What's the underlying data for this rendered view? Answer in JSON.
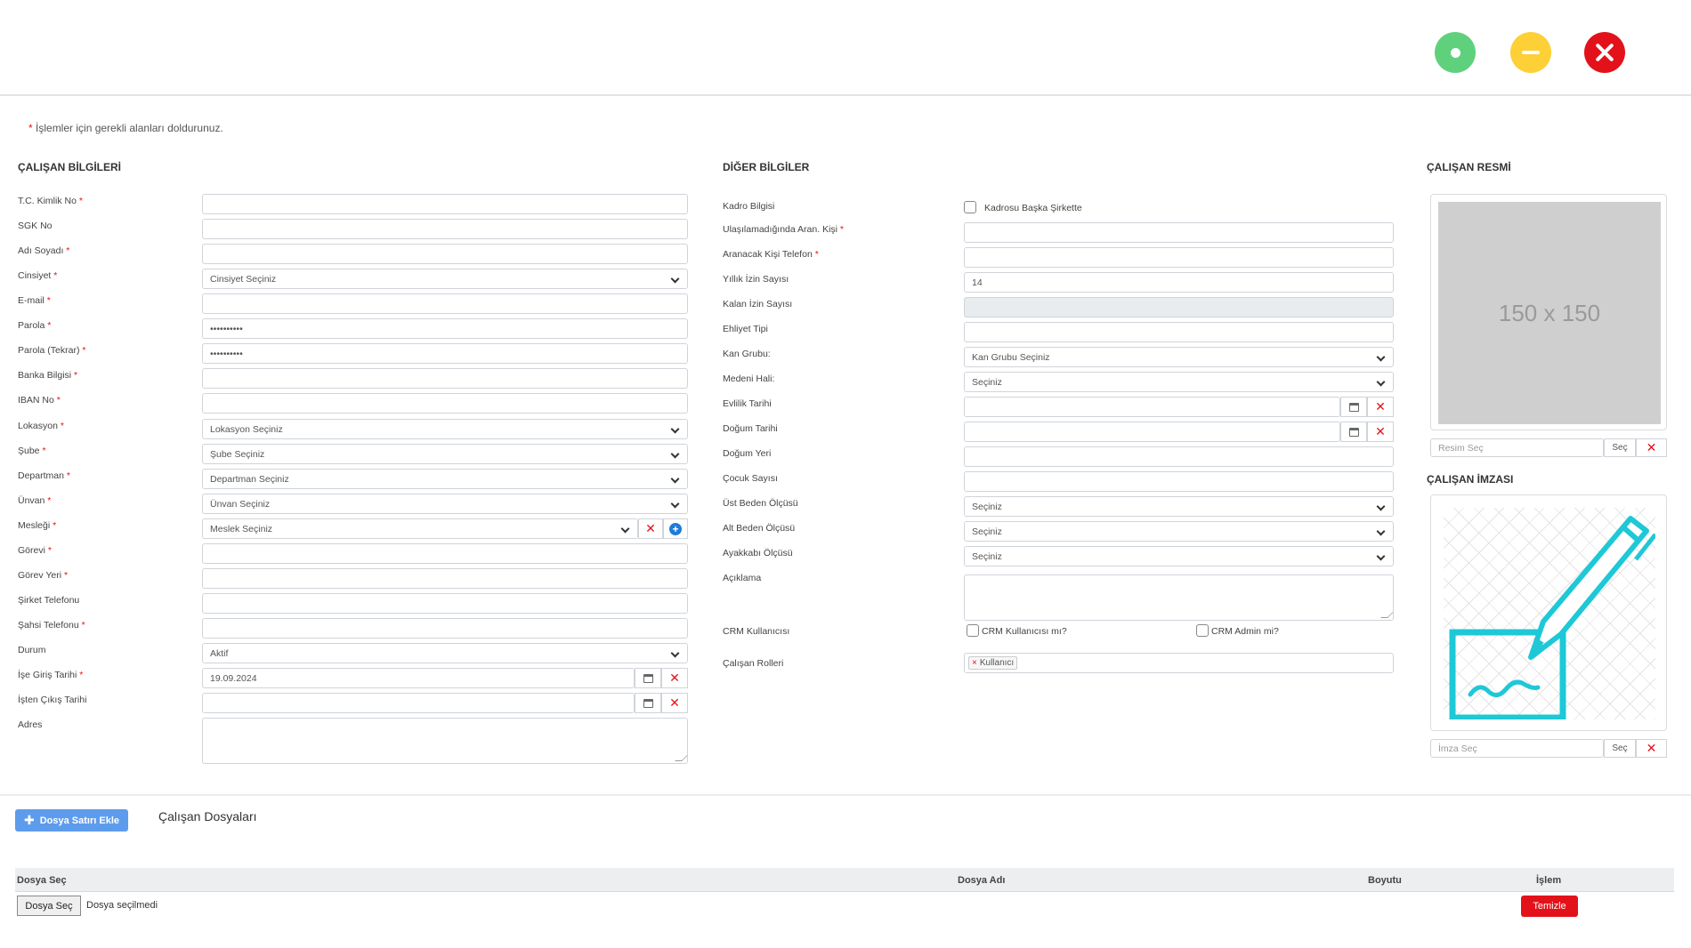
{
  "window": {
    "colors": {
      "green": "#5fd17c",
      "yellow": "#fcd036",
      "red": "#e3121a"
    }
  },
  "note": {
    "star": "*",
    "text": "İşlemler için gerekli alanları doldurunuz."
  },
  "left": {
    "title": "ÇALIŞAN BİLGİLERİ",
    "fields": [
      {
        "label": "T.C. Kimlik No",
        "required": "*",
        "value": ""
      },
      {
        "label": "SGK No",
        "required": "",
        "value": ""
      },
      {
        "label": "Adı Soyadı",
        "required": "*",
        "value": ""
      },
      {
        "label": "Cinsiyet",
        "required": "*",
        "value": "Cinsiyet Seçiniz"
      },
      {
        "label": "E-mail",
        "required": "*",
        "value": ""
      },
      {
        "label": "Parola",
        "required": "*",
        "value": "••••••••••"
      },
      {
        "label": "Parola (Tekrar)",
        "required": "*",
        "value": "••••••••••"
      },
      {
        "label": "Banka Bilgisi",
        "required": "*",
        "value": ""
      },
      {
        "label": "IBAN No",
        "required": "*",
        "value": ""
      },
      {
        "label": "Lokasyon",
        "required": "*",
        "value": "Lokasyon Seçiniz"
      },
      {
        "label": "Şube",
        "required": "*",
        "value": "Şube Seçiniz"
      },
      {
        "label": "Departman",
        "required": "*",
        "value": "Departman Seçiniz"
      },
      {
        "label": "Ünvan",
        "required": "*",
        "value": "Ünvan Seçiniz"
      },
      {
        "label": "Mesleği",
        "required": "*",
        "value": "Meslek Seçiniz"
      },
      {
        "label": "Görevi",
        "required": "*",
        "value": ""
      },
      {
        "label": "Görev Yeri",
        "required": "*",
        "value": ""
      },
      {
        "label": "Şirket Telefonu",
        "required": "",
        "value": ""
      },
      {
        "label": "Şahsi Telefonu",
        "required": "*",
        "value": ""
      },
      {
        "label": "Durum",
        "required": "",
        "value": "Aktif"
      },
      {
        "label": "İşe Giriş Tarihi",
        "required": "*",
        "value": "19.09.2024"
      },
      {
        "label": "İşten Çıkış Tarihi",
        "required": "",
        "value": ""
      },
      {
        "label": "Adres",
        "required": "",
        "value": ""
      }
    ]
  },
  "middle": {
    "title": "DİĞER BİLGİLER",
    "fields": [
      {
        "label": "Kadro Bilgisi",
        "required": "",
        "value": "Kadrosu Başka Şirkette"
      },
      {
        "label": "Ulaşılamadığında Aran. Kişi",
        "required": "*",
        "value": ""
      },
      {
        "label": "Aranacak Kişi Telefon",
        "required": "*",
        "value": ""
      },
      {
        "label": "Yıllık İzin Sayısı",
        "required": "",
        "value": "14"
      },
      {
        "label": "Kalan İzin Sayısı",
        "required": "",
        "value": ""
      },
      {
        "label": "Ehliyet Tipi",
        "required": "",
        "value": ""
      },
      {
        "label": "Kan Grubu:",
        "required": "",
        "value": "Kan Grubu Seçiniz"
      },
      {
        "label": "Medeni Hali:",
        "required": "",
        "value": "Seçiniz"
      },
      {
        "label": "Evlilik Tarihi",
        "required": "",
        "value": ""
      },
      {
        "label": "Doğum Tarihi",
        "required": "",
        "value": ""
      },
      {
        "label": "Doğum Yeri",
        "required": "",
        "value": ""
      },
      {
        "label": "Çocuk Sayısı",
        "required": "",
        "value": ""
      },
      {
        "label": "Üst Beden Ölçüsü",
        "required": "",
        "value": "Seçiniz"
      },
      {
        "label": "Alt Beden Ölçüsü",
        "required": "",
        "value": "Seçiniz"
      },
      {
        "label": "Ayakkabı Ölçüsü",
        "required": "",
        "value": "Seçiniz"
      },
      {
        "label": "Açıklama",
        "required": "",
        "value": ""
      },
      {
        "label": "CRM Kullanıcısı",
        "required": "",
        "value": ""
      },
      {
        "label": "Çalışan Rolleri",
        "required": "",
        "value": ""
      }
    ],
    "crm_user_label": "CRM Kullanıcısı mı?",
    "crm_admin_label": "CRM Admin mi?",
    "role_tag": {
      "remove": "×",
      "label": "Kullanıcı"
    }
  },
  "right": {
    "photo_title": "ÇALIŞAN RESMİ",
    "photo_placeholder": "150 x 150",
    "photo_input_placeholder": "Resim Seç",
    "signature_title": "ÇALIŞAN İMZASI",
    "signature_input_placeholder": "İmza Seç",
    "choose_label": "Seç"
  },
  "files": {
    "add_button": "Dosya Satırı Ekle",
    "title": "Çalışan Dosyaları",
    "columns": [
      "Dosya Seç",
      "Dosya Adı",
      "Boyutu",
      "İşlem"
    ],
    "row": {
      "file_button": "Dosya Seç",
      "file_status": "Dosya seçilmedi",
      "clear_button": "Temizle"
    }
  }
}
